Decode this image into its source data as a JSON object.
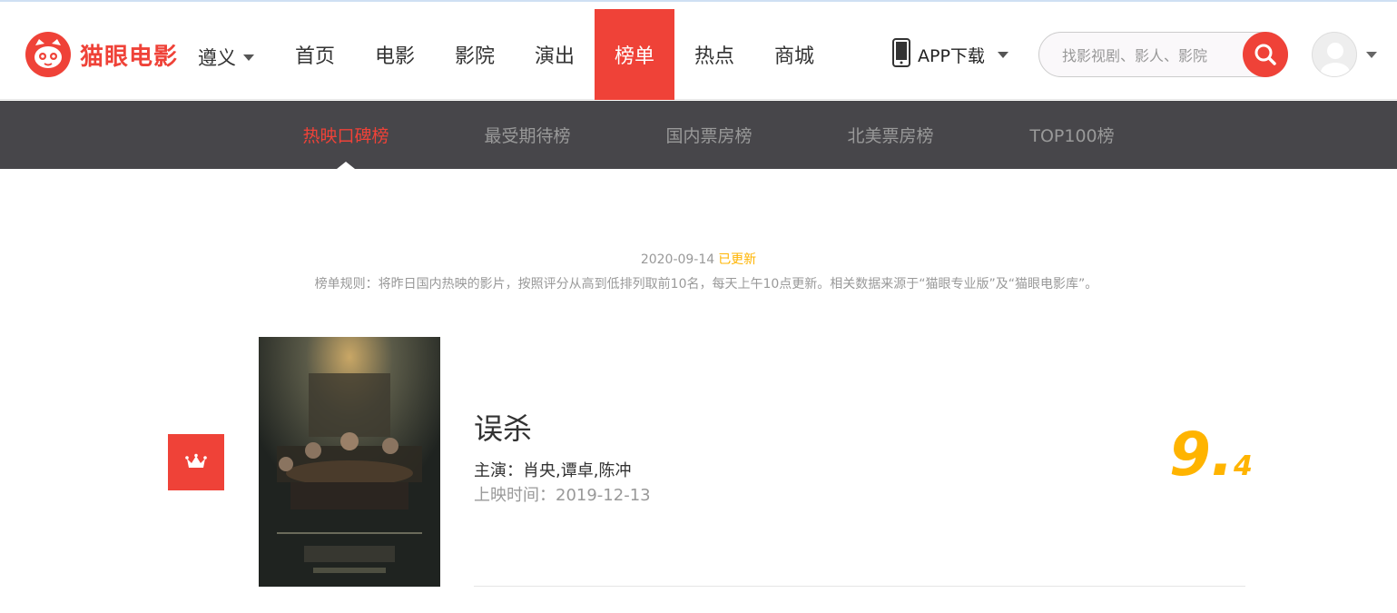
{
  "header": {
    "logo_text": "猫眼电影",
    "city": "遵义",
    "nav": [
      {
        "label": "首页",
        "active": false
      },
      {
        "label": "电影",
        "active": false
      },
      {
        "label": "影院",
        "active": false
      },
      {
        "label": "演出",
        "active": false
      },
      {
        "label": "榜单",
        "active": true
      },
      {
        "label": "热点",
        "active": false
      },
      {
        "label": "商城",
        "active": false
      }
    ],
    "app_download": "APP下载",
    "search_placeholder": "找影视剧、影人、影院"
  },
  "subnav": {
    "items": [
      {
        "label": "热映口碑榜",
        "active": true
      },
      {
        "label": "最受期待榜",
        "active": false
      },
      {
        "label": "国内票房榜",
        "active": false
      },
      {
        "label": "北美票房榜",
        "active": false
      },
      {
        "label": "TOP100榜",
        "active": false
      }
    ]
  },
  "board": {
    "update_date": "2020-09-14",
    "updated_label": "已更新",
    "rule": "榜单规则：将昨日国内热映的影片，按照评分从高到低排列取前10名，每天上午10点更新。相关数据来源于“猫眼专业版”及“猫眼电影库”。"
  },
  "movies": [
    {
      "rank": 1,
      "title": "误杀",
      "stars": "主演：肖央,谭卓,陈冲",
      "release": "上映时间：2019-12-13",
      "score_int": "9.",
      "score_frac": "4"
    }
  ],
  "colors": {
    "brand_red": "#ef4238",
    "subnav_bg": "#47464a",
    "score_gold": "#ffb400"
  }
}
